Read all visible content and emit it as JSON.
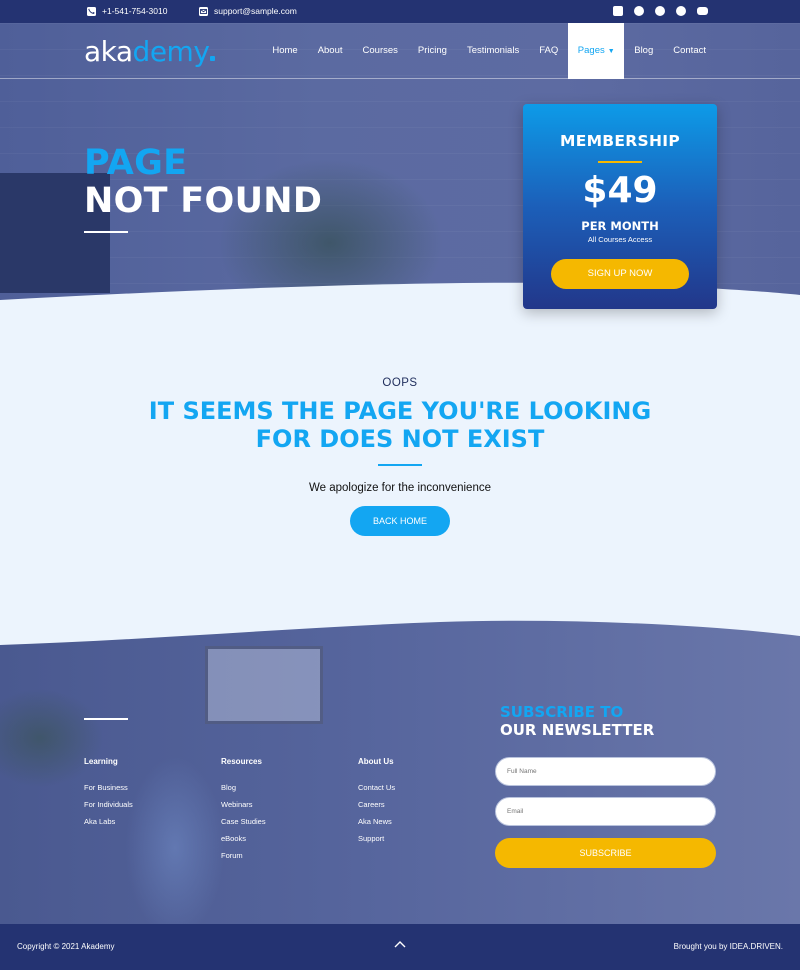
{
  "topbar": {
    "phone": "+1-541-754-3010",
    "email": "support@sample.com",
    "social_icons": [
      "linkedin-icon",
      "facebook-icon",
      "twitter-icon",
      "skype-icon",
      "youtube-icon"
    ]
  },
  "nav": {
    "logo_part1": "aka",
    "logo_part2": "demy",
    "items": [
      {
        "label": "Home"
      },
      {
        "label": "About"
      },
      {
        "label": "Courses"
      },
      {
        "label": "Pricing"
      },
      {
        "label": "Testimonials"
      },
      {
        "label": "FAQ"
      },
      {
        "label": "Pages",
        "active": true
      },
      {
        "label": "Blog"
      },
      {
        "label": "Contact"
      }
    ]
  },
  "hero": {
    "title_line1": "PAGE",
    "title_line2": "NOT FOUND"
  },
  "membership": {
    "title": "MEMBERSHIP",
    "price": "$49",
    "period": "PER MONTH",
    "subtitle": "All Courses Access",
    "button": "SIGN UP NOW"
  },
  "content": {
    "eyebrow": "OOPS",
    "heading_line1": "IT SEEMS THE PAGE YOU'RE LOOKING",
    "heading_line2": "FOR DOES NOT EXIST",
    "apology": "We apologize for the inconvenience",
    "back_button": "BACK HOME"
  },
  "footer": {
    "columns": [
      {
        "title": "Learning",
        "links": [
          "For Business",
          "For Individuals",
          "Aka Labs"
        ]
      },
      {
        "title": "Resources",
        "links": [
          "Blog",
          "Webinars",
          "Case Studies",
          "eBooks",
          "Forum"
        ]
      },
      {
        "title": "About Us",
        "links": [
          "Contact Us",
          "Careers",
          "Aka News",
          "Support"
        ]
      }
    ],
    "newsletter_line1": "SUBSCRIBE TO",
    "newsletter_line2": "OUR NEWSLETTER",
    "name_placeholder": "Full Name",
    "email_placeholder": "Email",
    "subscribe_button": "SUBSCRIBE"
  },
  "bottom": {
    "copyright": "Copyright © 2021 Akademy",
    "credit": "Brought you by IDEA.DRIVEN."
  },
  "colors": {
    "accent": "#13a6f2",
    "navy": "#243372",
    "yellow": "#f5b800"
  }
}
